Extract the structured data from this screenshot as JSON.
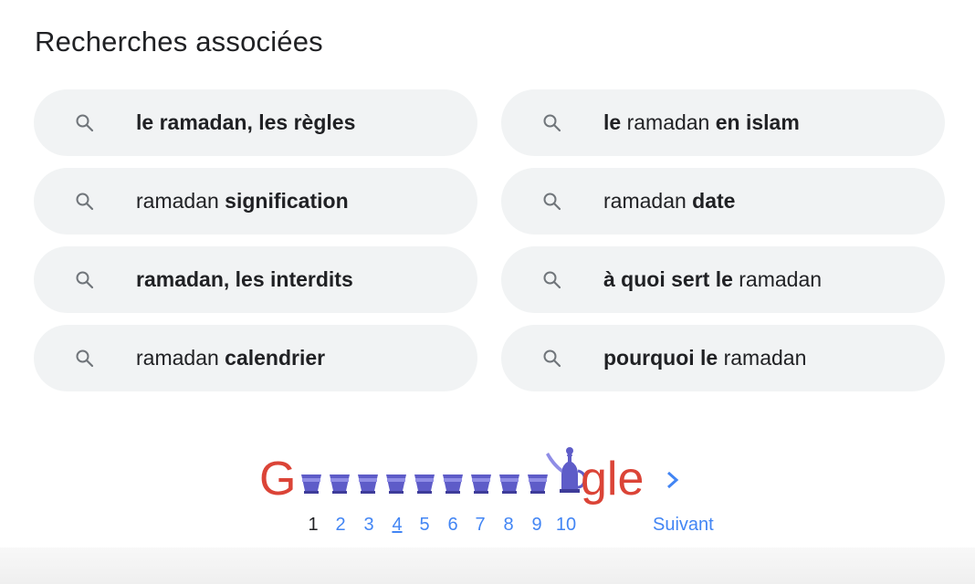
{
  "section_title": "Recherches associées",
  "related_searches": [
    [
      {
        "t": "le ramadan, les règles",
        "b": true
      }
    ],
    [
      {
        "t": "le",
        "b": true
      },
      {
        "t": " ramadan ",
        "b": false
      },
      {
        "t": "en islam",
        "b": true
      }
    ],
    [
      {
        "t": "ramadan ",
        "b": false
      },
      {
        "t": "signification",
        "b": true
      }
    ],
    [
      {
        "t": "ramadan ",
        "b": false
      },
      {
        "t": "date",
        "b": true
      }
    ],
    [
      {
        "t": "ramadan, les interdits",
        "b": true
      }
    ],
    [
      {
        "t": "à quoi sert le",
        "b": true
      },
      {
        "t": " ramadan",
        "b": false
      }
    ],
    [
      {
        "t": "ramadan ",
        "b": false
      },
      {
        "t": "calendrier",
        "b": true
      }
    ],
    [
      {
        "t": "pourquoi le",
        "b": true
      },
      {
        "t": " ramadan",
        "b": false
      }
    ]
  ],
  "pagination": {
    "logo_letters": {
      "first": "G",
      "last": "gle"
    },
    "cup_count": 9,
    "pages": [
      "1",
      "2",
      "3",
      "4",
      "5",
      "6",
      "7",
      "8",
      "9",
      "10"
    ],
    "current_page": "1",
    "hovered_page": "4",
    "next_label": "Suivant"
  },
  "colors": {
    "chip_background": "#f1f3f4",
    "link_blue": "#4285f4",
    "google_red": "#db4437",
    "cup_purple": "#5e5cc8",
    "cup_light": "#8f8de6",
    "text": "#202124"
  },
  "icons": {
    "chip_icon": "search-icon",
    "next_icon": "chevron-right-icon"
  }
}
